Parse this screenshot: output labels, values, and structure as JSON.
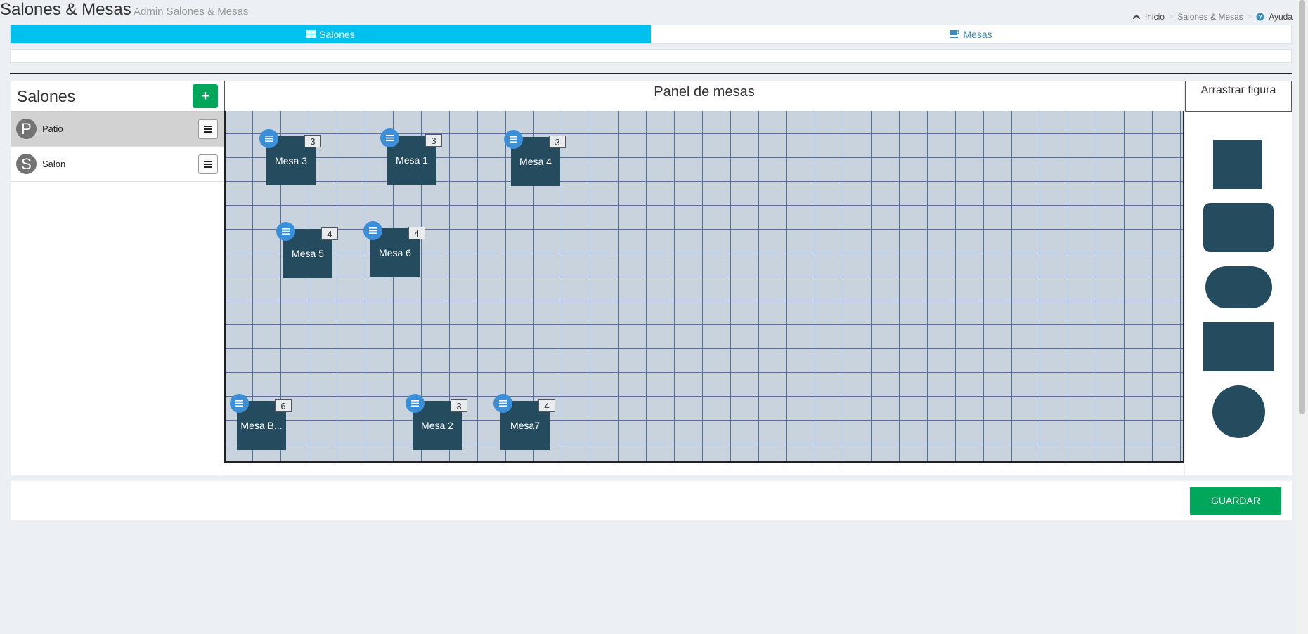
{
  "header": {
    "title": "Salones & Mesas",
    "subtitle": "Admin Salones & Mesas",
    "breadcrumb": {
      "home": "Inicio",
      "current": "Salones & Mesas",
      "help": "Ayuda"
    }
  },
  "tabs": [
    {
      "label": "Salones",
      "icon": "grid-icon",
      "active": true
    },
    {
      "label": "Mesas",
      "icon": "cup-icon",
      "active": false
    }
  ],
  "salones": {
    "title": "Salones",
    "add_icon": "+",
    "items": [
      {
        "initial": "P",
        "name": "Patio",
        "selected": true
      },
      {
        "initial": "S",
        "name": "Salon",
        "selected": false
      }
    ]
  },
  "panel": {
    "title": "Panel de mesas",
    "mesas": [
      {
        "name": "Mesa 3",
        "seats": "3"
      },
      {
        "name": "Mesa 1",
        "seats": "3"
      },
      {
        "name": "Mesa 4",
        "seats": "3"
      },
      {
        "name": "Mesa 5",
        "seats": "4"
      },
      {
        "name": "Mesa 6",
        "seats": "4"
      },
      {
        "name": "Mesa B...",
        "seats": "6"
      },
      {
        "name": "Mesa 2",
        "seats": "3"
      },
      {
        "name": "Mesa7",
        "seats": "4"
      }
    ]
  },
  "figures": {
    "title": "Arrastrar figura",
    "shapes": [
      "square",
      "rounded-rectangle",
      "pill",
      "rectangle",
      "circle"
    ]
  },
  "footer": {
    "save_label": "GUARDAR"
  },
  "colors": {
    "accent": "#00c0ef",
    "success": "#00a65a",
    "table": "#254b5f",
    "link": "#3c8dbc"
  }
}
